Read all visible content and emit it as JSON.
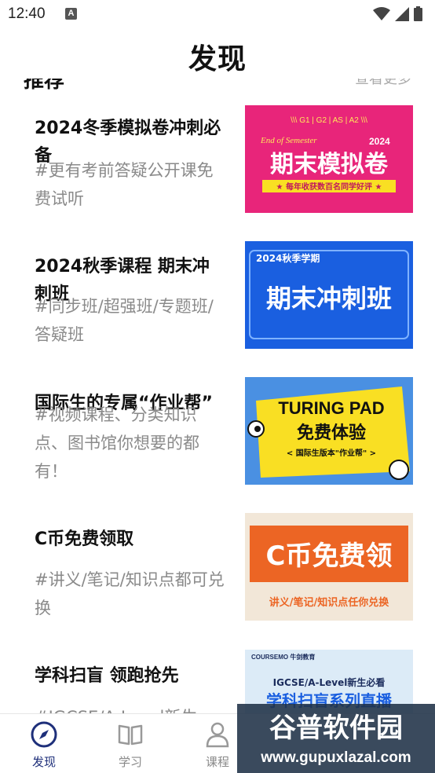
{
  "status_bar": {
    "time": "12:40",
    "notification_icon": "A"
  },
  "header": {
    "title": "发现"
  },
  "section": {
    "heading": "推荐",
    "more": "查看更多"
  },
  "cards": [
    {
      "title": "2024冬季模拟卷冲刺必备",
      "desc": "#更有考前答疑公开课免费试听",
      "thumb": {
        "tags": "\\\\\\  G1 | G2 | AS | A2  \\\\\\",
        "sub": "End of Semester",
        "year": "2024",
        "main": "期末模拟卷",
        "footer": "★ 每年收获数百名同学好评 ★"
      }
    },
    {
      "title": "2024秋季课程 期末冲刺班",
      "desc": "#同步班/超强班/专题班/答疑班",
      "thumb": {
        "badge": "2024秋季学期",
        "main": "期末冲刺班"
      }
    },
    {
      "title": "国际生的专属“作业帮”",
      "desc": "#视频课程、分类知识点、图书馆你想要的都有！",
      "thumb": {
        "line1": "TURING PAD",
        "line2": "免费体验",
        "line3": "< 国际生版本\"作业帮\" >"
      }
    },
    {
      "title": "C币免费领取",
      "desc": "#讲义/笔记/知识点都可兑换",
      "thumb": {
        "main": "C币免费领",
        "sub": "讲义/笔记/知识点任你兑换"
      }
    },
    {
      "title": "学科扫盲 领跑抢先",
      "desc": "#IGCSE/A-Level新生",
      "thumb": {
        "brand": "COURSEMO 牛剑教育",
        "line1": "IGCSE/A-Level新生必看",
        "line2": "学科扫盲系列直播"
      }
    }
  ],
  "tabs": [
    {
      "label": "发现",
      "icon": "compass-icon",
      "active": true
    },
    {
      "label": "学习",
      "icon": "book-icon",
      "active": false
    },
    {
      "label": "课程",
      "icon": "person-icon",
      "active": false
    }
  ],
  "watermark": {
    "name": "谷普软件园",
    "url": "www.gupuxlazal.com"
  },
  "colors": {
    "accent": "#1e2f7a",
    "pink": "#e8257a",
    "blue": "#1a5fe0",
    "yellow": "#f9df23",
    "orange": "#ec6524"
  }
}
